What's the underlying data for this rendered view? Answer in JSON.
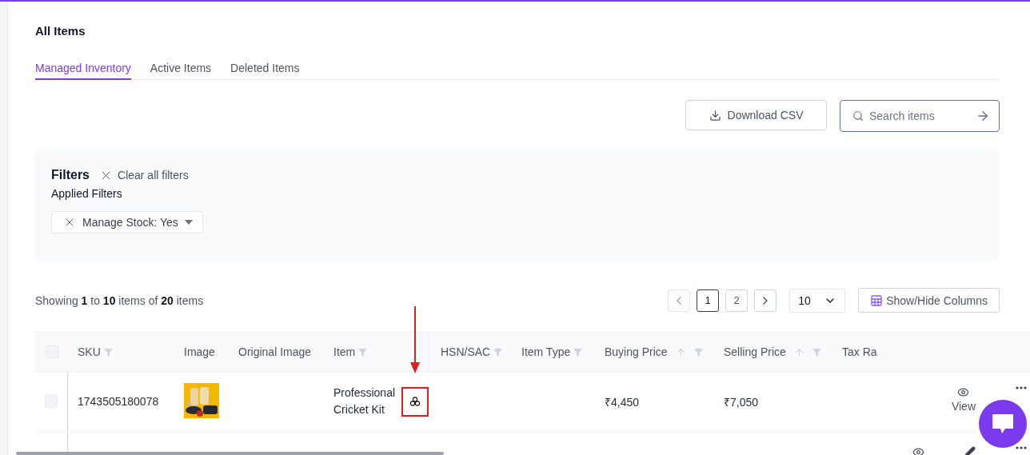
{
  "page": {
    "title": "All Items"
  },
  "tabs": [
    {
      "label": "Managed Inventory",
      "selected": true
    },
    {
      "label": "Active Items",
      "selected": false
    },
    {
      "label": "Deleted Items",
      "selected": false
    }
  ],
  "toolbar": {
    "download_button": "Download CSV",
    "search": {
      "placeholder": "Search items"
    }
  },
  "filters": {
    "title": "Filters",
    "clear_label": "Clear all filters",
    "applied_label": "Applied Filters",
    "chips": [
      {
        "label": "Manage Stock: Yes"
      }
    ]
  },
  "summary": "Showing **1** to **10** items of **20** items",
  "pagination": {
    "prev_disabled": true,
    "pages": [
      {
        "label": "1",
        "selected": true
      },
      {
        "label": "2",
        "selected": false
      }
    ],
    "page_size": "10",
    "columns_button": "Show/Hide Columns"
  },
  "table": {
    "select_all_checked": false,
    "columns": [
      {
        "label": "SKU",
        "filter": true,
        "sortable": false
      },
      {
        "label": "Image",
        "filter": false,
        "sortable": false
      },
      {
        "label": "Original Image",
        "filter": false,
        "sortable": false
      },
      {
        "label": "Item",
        "filter": true,
        "sortable": false
      },
      {
        "label": "HSN/SAC",
        "filter": true,
        "sortable": false
      },
      {
        "label": "Item Type",
        "filter": true,
        "sortable": false
      },
      {
        "label": "Buying Price",
        "filter": true,
        "sortable": true
      },
      {
        "label": "Selling Price",
        "filter": true,
        "sortable": true
      },
      {
        "label": "Tax Ra"
      }
    ],
    "rows": [
      {
        "checked": false,
        "sku": "1743505180078",
        "image": {
          "kind": "picture"
        },
        "item": "Professional Cricket Kit",
        "variant_highlighted": true,
        "buying_price": "₹4,450",
        "selling_price": "₹7,050",
        "actions": [
          {
            "kind": "view",
            "label": "View"
          },
          {
            "kind": "more"
          }
        ]
      },
      {
        "actions": [
          {
            "kind": "view"
          },
          {
            "kind": "edit"
          },
          {
            "kind": "more"
          }
        ]
      }
    ]
  }
}
